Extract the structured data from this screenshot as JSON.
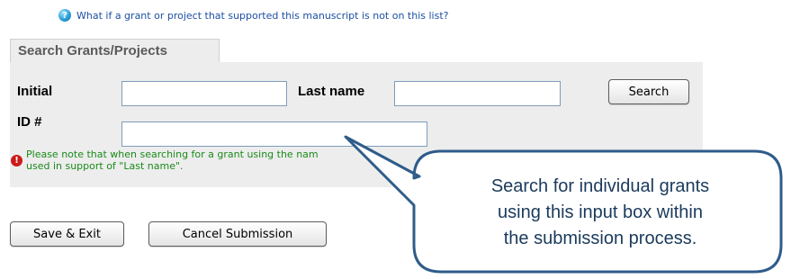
{
  "help": {
    "icon": "help-icon",
    "text": "What if a grant or project that supported this manuscript is not on this list?"
  },
  "search_panel": {
    "tab_label": "Search Grants/Projects",
    "initial_label": "Initial",
    "initial_value": "",
    "last_name_label": "Last name",
    "last_name_value": "",
    "id_label": "ID #",
    "id_value": "",
    "search_button": "Search",
    "warning_icon": "exclamation-icon",
    "warning_line1": "Please note that when searching for a grant using the nam",
    "warning_line2": "used in support of \"Last name\"."
  },
  "actions": {
    "save_exit": "Save & Exit",
    "cancel_submission": "Cancel Submission"
  },
  "callout": {
    "line1": "Search for individual grants",
    "line2": "using this input box within",
    "line3": "the submission process.",
    "color": "#1a3a5c",
    "border_color": "#2e5c8a"
  }
}
